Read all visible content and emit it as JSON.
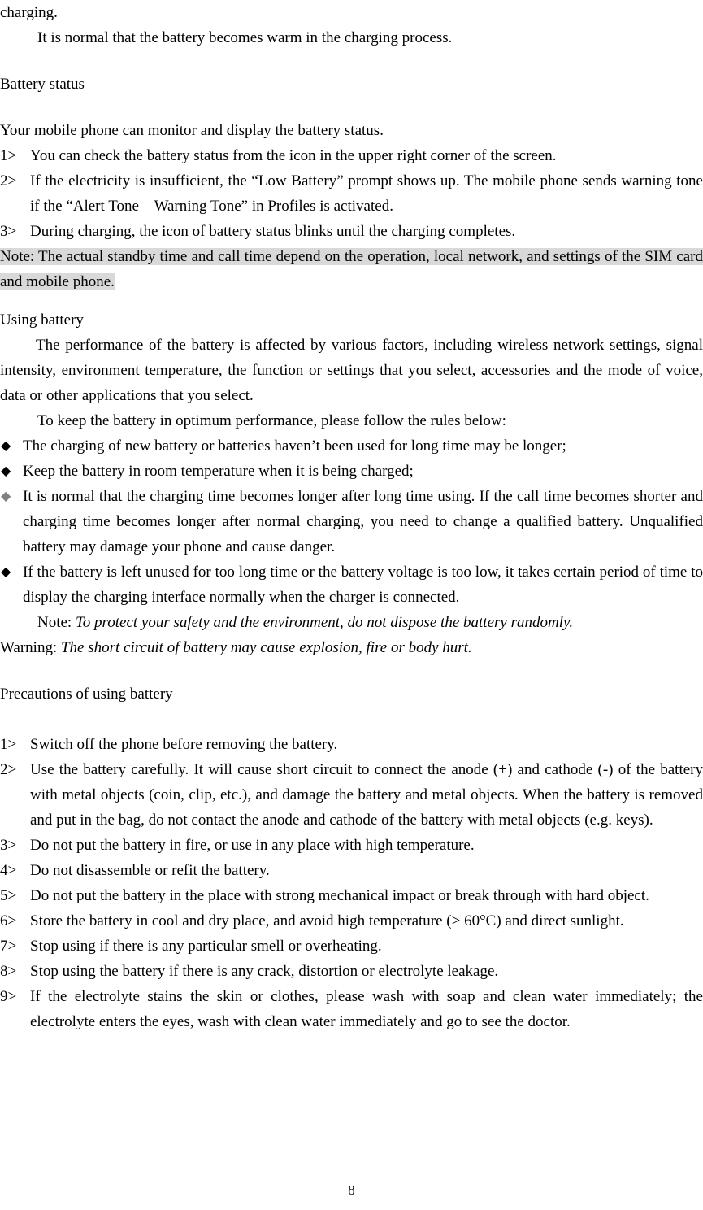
{
  "document": {
    "page_number": "8",
    "highlight_color": "#d9d9d9",
    "gray_bullet_color": "#808080",
    "bullet_glyph": "◆"
  },
  "top": {
    "continued_line": "charging.",
    "indented_note": "It is normal that the battery becomes warm in the charging process."
  },
  "battery_status": {
    "heading": "Battery status",
    "intro": "Your mobile phone can monitor and display the battery status.",
    "items": [
      {
        "marker": "1>",
        "text": "You can check the battery status from the icon in the upper right corner of the screen."
      },
      {
        "marker": "2>",
        "text": "If the electricity is insufficient, the “Low Battery” prompt shows up. The mobile phone sends warning tone if the “Alert Tone – Warning Tone” in Profiles is activated."
      },
      {
        "marker": "3>",
        "text": "During charging, the icon of battery status blinks until the charging completes."
      }
    ],
    "note_highlighted": "Note: The actual standby time and call time depend on the operation, local network, and settings of the SIM card and mobile phone."
  },
  "using_battery": {
    "heading": "Using battery",
    "paragraph1": "The performance of the battery is affected by various factors, including wireless network settings, signal intensity, environment temperature, the function or settings that you select, accessories and the mode of voice, data or other applications that you select.",
    "paragraph2": "To keep the battery in optimum performance, please follow the rules below:",
    "bullets": [
      {
        "color": "black",
        "text": "The charging of new battery or batteries haven’t been used for long time may be longer;"
      },
      {
        "color": "black",
        "text": "Keep the battery in room temperature when it is being charged;"
      },
      {
        "color": "gray",
        "text": "It is normal that the charging time becomes longer after long time using. If the call time becomes shorter and charging time becomes longer after normal charging, you need to change a qualified battery. Unqualified battery may damage your phone and cause danger."
      },
      {
        "color": "black",
        "text": "If the battery is left unused for too long time or the battery voltage is too low, it takes certain period of time to display the charging interface normally when the charger is connected."
      }
    ],
    "note_label": "Note: ",
    "note_italic": "To protect your safety and the environment, do not dispose the battery randomly.",
    "warning_label": "Warning: ",
    "warning_italic": "The short circuit of battery may cause explosion, fire or body hurt."
  },
  "precautions": {
    "heading": "Precautions of using battery",
    "items": [
      {
        "marker": "1>",
        "text": "Switch off the phone before removing the battery."
      },
      {
        "marker": "2>",
        "text": "Use the battery carefully. It will cause short circuit to connect the anode (+) and cathode (-) of the battery with metal objects (coin, clip, etc.), and damage the battery and metal objects. When the battery is removed and put in the bag, do not contact the anode and cathode of the battery with metal objects (e.g. keys)."
      },
      {
        "marker": "3>",
        "text": "Do not put the battery in fire, or use in any place with high temperature."
      },
      {
        "marker": "4>",
        "text": "Do not disassemble or refit the battery."
      },
      {
        "marker": "5>",
        "text": "Do not put the battery in the place with strong mechanical impact or break through with hard object."
      },
      {
        "marker": "6>",
        "text": "Store the battery in cool and dry place, and avoid high temperature (> 60°C) and direct sunlight."
      },
      {
        "marker": "7>",
        "text": "Stop using if there is any particular smell or overheating."
      },
      {
        "marker": "8>",
        "text": "Stop using the battery if there is any crack, distortion or electrolyte leakage."
      },
      {
        "marker": "9>",
        "text": "If the electrolyte stains the skin or clothes, please wash with soap and clean water immediately; the electrolyte enters the eyes, wash with clean water immediately and go to see the doctor."
      }
    ]
  }
}
